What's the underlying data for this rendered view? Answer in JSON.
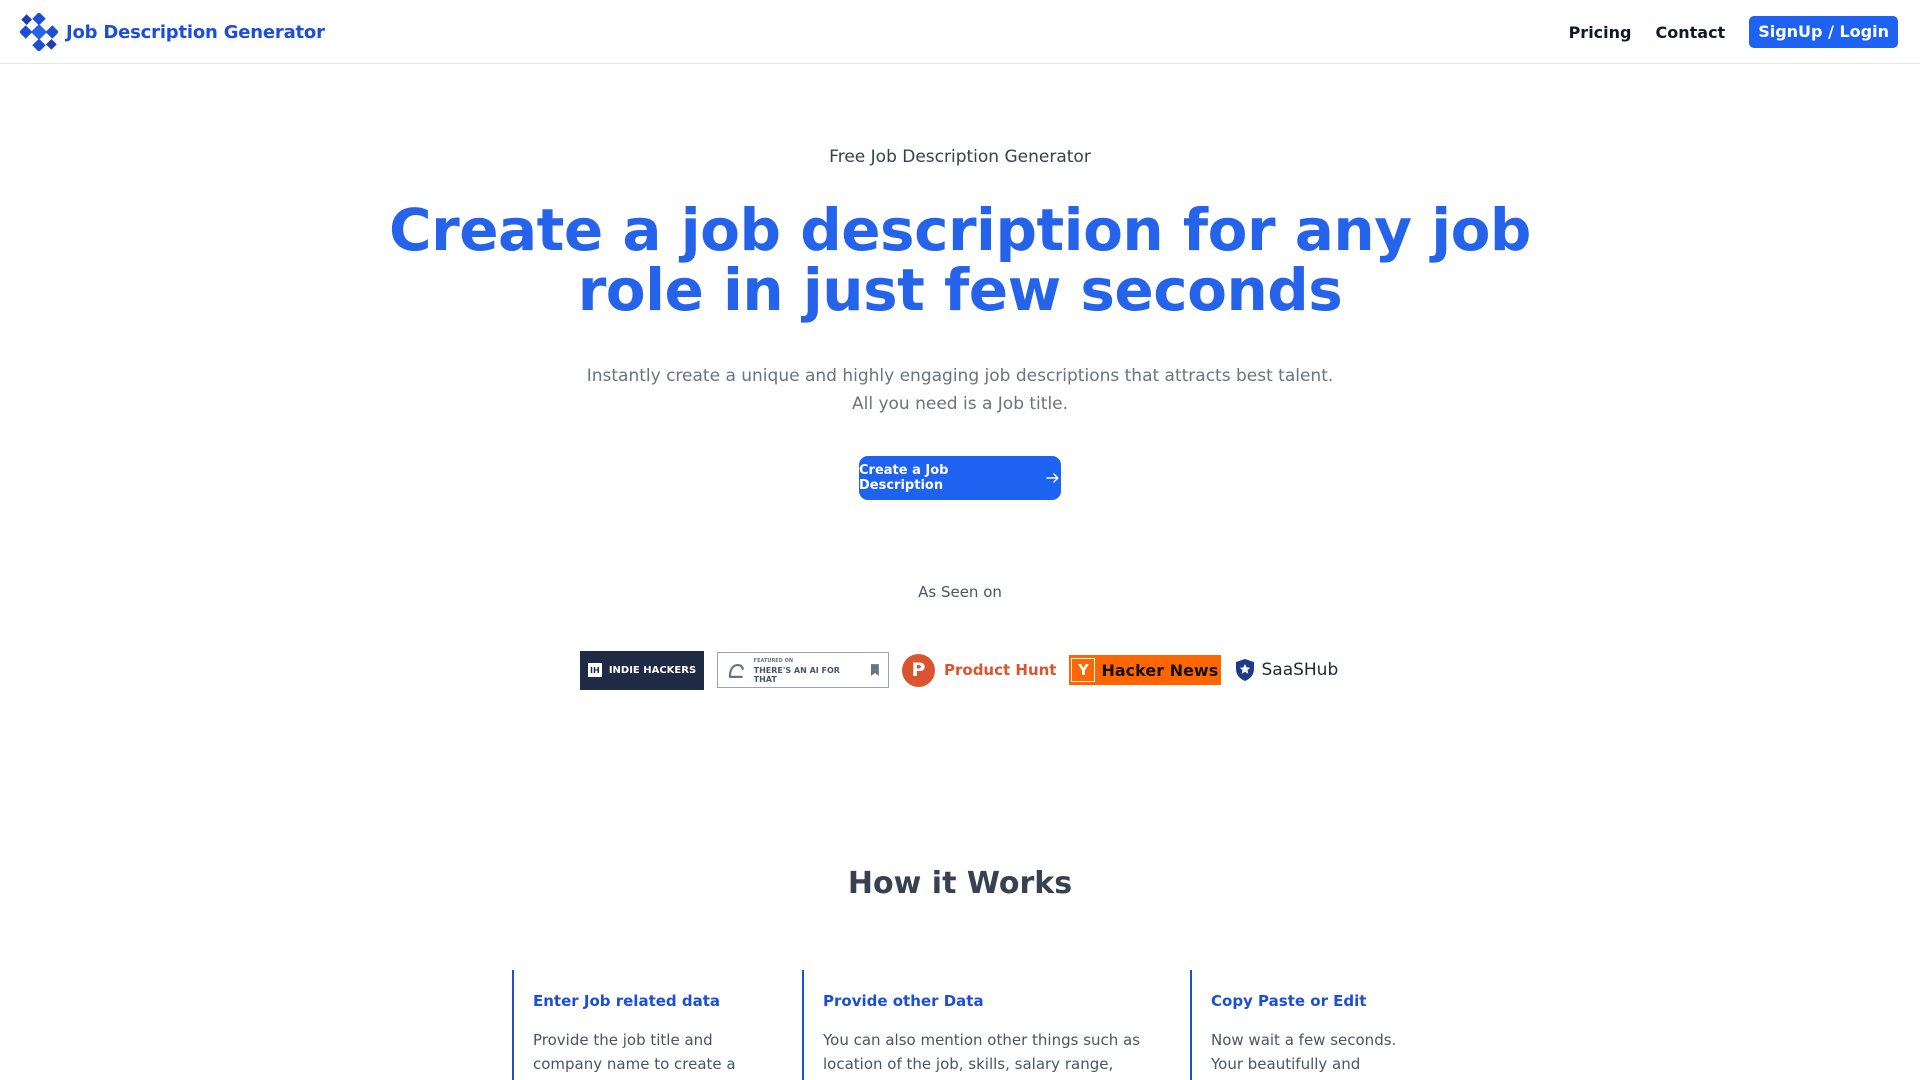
{
  "nav": {
    "brand": "Job Description Generator",
    "links": [
      "Pricing",
      "Contact"
    ],
    "cta": "SignUp / Login"
  },
  "hero": {
    "eyebrow": "Free Job Description Generator",
    "title_line1": "Create a job description for any job",
    "title_line2": "role in just few seconds",
    "subtitle_line1": "Instantly create a unique and highly engaging job descriptions that attracts best talent.",
    "subtitle_line2": "All you need is a Job title.",
    "cta": "Create a Job Description"
  },
  "seen_on": {
    "label": "As Seen on",
    "indie_hackers": "INDIE HACKERS",
    "indie_hackers_mark": "IH",
    "aift_small": "FEATURED ON",
    "aift_big": "THERE'S AN AI FOR THAT",
    "product_hunt": "Product Hunt",
    "product_hunt_mark": "P",
    "hacker_news": "Hacker News",
    "hacker_news_mark": "Y",
    "saashub": "SaaSHub"
  },
  "how": {
    "title": "How it Works",
    "steps": [
      {
        "title": "Enter Job related data",
        "line1": "Provide the job title and",
        "line2": "company name to create a"
      },
      {
        "title": "Provide other Data",
        "line1": "You can also mention other things such as",
        "line2": "location of the job, skills, salary range,"
      },
      {
        "title": "Copy Paste or Edit",
        "line1": "Now wait a few seconds.",
        "line2": "Your beautifully and"
      }
    ]
  },
  "colors": {
    "primary": "#2563eb",
    "button": "#1d62f0",
    "product_hunt": "#da552f",
    "hacker_news": "#ff6600"
  }
}
